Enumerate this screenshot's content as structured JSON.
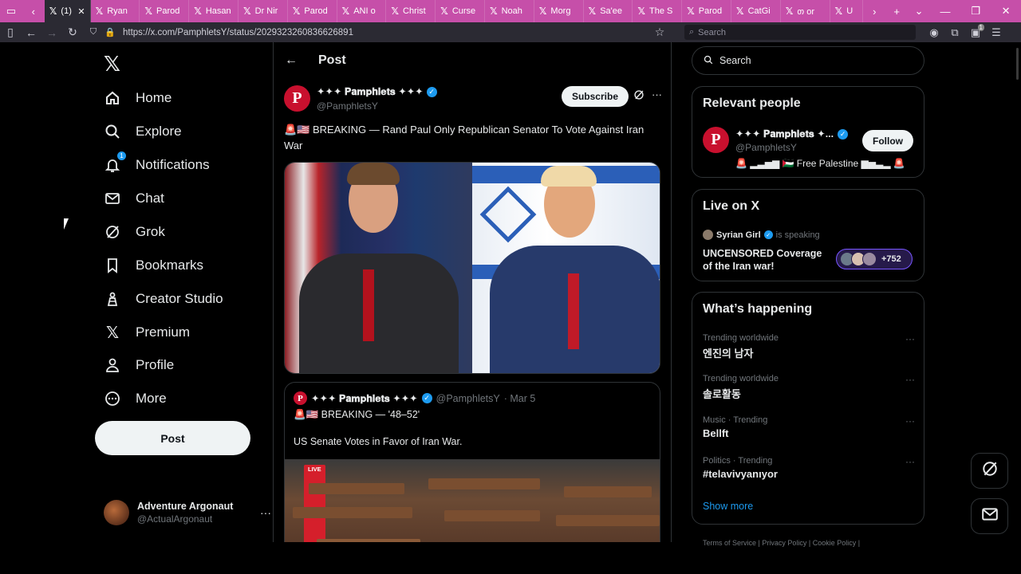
{
  "browser": {
    "tabs": [
      {
        "label": "(1)",
        "active": true
      },
      {
        "label": "Ryan"
      },
      {
        "label": "Parod"
      },
      {
        "label": "Hasan"
      },
      {
        "label": "Dr Nir"
      },
      {
        "label": "Parod"
      },
      {
        "label": "ANI o"
      },
      {
        "label": "Christ"
      },
      {
        "label": "Curse"
      },
      {
        "label": "Noah"
      },
      {
        "label": "Morg"
      },
      {
        "label": "Sa'ee"
      },
      {
        "label": "The S"
      },
      {
        "label": "Parod"
      },
      {
        "label": "CatGi"
      },
      {
        "label": "თ or"
      },
      {
        "label": "U"
      }
    ],
    "url": "https://x.com/PamphletsY/status/2029323260836626891",
    "search_placeholder": "Search",
    "extension_badge": "1"
  },
  "nav": {
    "items": [
      {
        "label": "Home",
        "icon": "home-icon"
      },
      {
        "label": "Explore",
        "icon": "search-icon"
      },
      {
        "label": "Notifications",
        "icon": "bell-icon",
        "badge": "1"
      },
      {
        "label": "Chat",
        "icon": "mail-icon"
      },
      {
        "label": "Grok",
        "icon": "grok-icon"
      },
      {
        "label": "Bookmarks",
        "icon": "bookmark-icon"
      },
      {
        "label": "Creator Studio",
        "icon": "creator-studio-icon"
      },
      {
        "label": "Premium",
        "icon": "x-logo-icon"
      },
      {
        "label": "Profile",
        "icon": "profile-icon"
      },
      {
        "label": "More",
        "icon": "more-circle-icon"
      }
    ],
    "post_label": "Post",
    "account": {
      "name": "Adventure Argonaut",
      "handle": "@ActualArgonaut"
    }
  },
  "post": {
    "header_title": "Post",
    "author": {
      "name": "✦✦✦ 𝐏𝐚𝐦𝐩𝐡𝐥𝐞𝐭𝐬 ✦✦✦",
      "handle": "@PamphletsY",
      "avatar_letter": "P"
    },
    "subscribe_label": "Subscribe",
    "text": "🚨🇺🇸 BREAKING — Rand Paul Only Republican Senator To Vote Against Iran War",
    "quote": {
      "author_name": "✦✦✦ 𝐏𝐚𝐦𝐩𝐡𝐥𝐞𝐭𝐬 ✦✦✦",
      "handle": "@PamphletsY",
      "date": "· Mar 5",
      "line1": "🚨🇺🇸 BREAKING — '48–52'",
      "line2": "US Senate Votes in Favor of Iran War.",
      "live_label": "LIVE"
    }
  },
  "right": {
    "search_placeholder": "Search",
    "relevant": {
      "title": "Relevant people",
      "name": "✦✦✦ 𝐏𝐚𝐦𝐩𝐡𝐥𝐞𝐭𝐬 ✦...",
      "handle": "@PamphletsY",
      "bio": "🚨 ▂▃▅▆ 🇵🇸 Free Palestine ▆▅▃▂ 🚨",
      "follow_label": "Follow"
    },
    "live": {
      "title": "Live on X",
      "speaker": "Syrian Girl",
      "speaking_text": "is speaking",
      "space_title": "UNCENSORED Coverage of the Iran war!",
      "listener_count": "+752"
    },
    "happening": {
      "title": "What’s happening",
      "trends": [
        {
          "context": "Trending worldwide",
          "topic": "엔진의 남자"
        },
        {
          "context": "Trending worldwide",
          "topic": "솔로활동"
        },
        {
          "context": "Music · Trending",
          "topic": "Bellft"
        },
        {
          "context": "Politics · Trending",
          "topic": "#telavivyanıyor"
        }
      ],
      "show_more": "Show more"
    },
    "footer": "Terms of Service  |  Privacy Policy  |  Cookie Policy  |"
  },
  "colors": {
    "tabbar": "#c64fa9",
    "accent": "#1d9bf0",
    "background": "#000000",
    "border": "#2f3336",
    "avatar_red": "#c8102e"
  }
}
